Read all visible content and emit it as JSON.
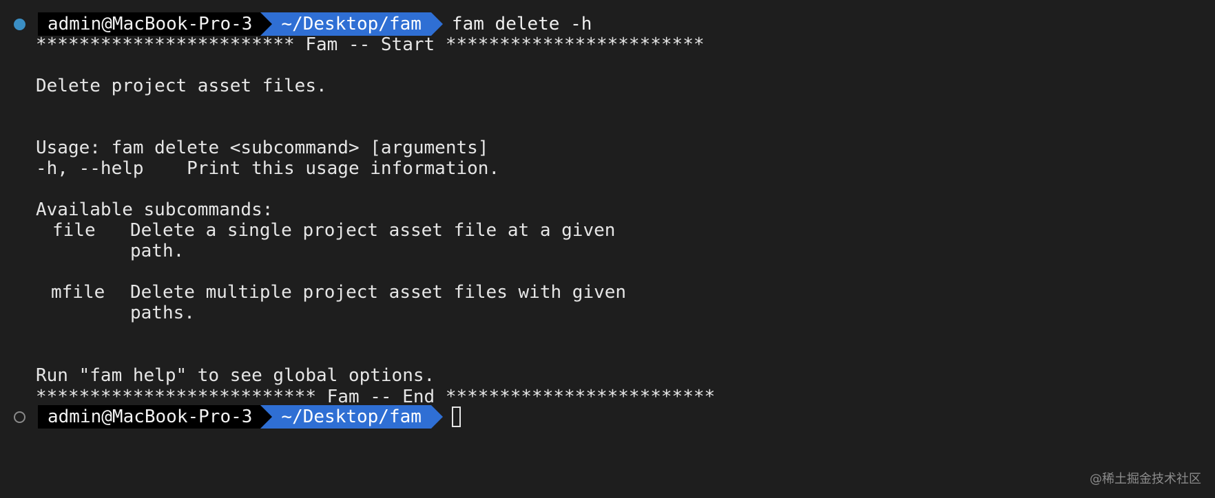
{
  "prompt": {
    "user_host": "admin@MacBook-Pro-3",
    "directory": "~/Desktop/fam",
    "command": "fam delete -h"
  },
  "output": {
    "banner_start": "************************ Fam -- Start ************************",
    "description": "Delete project asset files.",
    "usage": "Usage: fam delete <subcommand> [arguments]",
    "help_option": "-h, --help    Print this usage information.",
    "available_header": "Available subcommands:",
    "subcommands": [
      {
        "name": "file",
        "desc_line1": "Delete a single project asset file at a given",
        "desc_line2": "path."
      },
      {
        "name": "mfile",
        "desc_line1": "Delete multiple project asset files with given",
        "desc_line2": "paths."
      }
    ],
    "run_hint": "Run \"fam help\" to see global options.",
    "banner_end": "************************** Fam -- End *************************"
  },
  "prompt2": {
    "user_host": "admin@MacBook-Pro-3",
    "directory": "~/Desktop/fam"
  },
  "watermark": "@稀土掘金技术社区",
  "colors": {
    "background": "#1e1e1e",
    "text": "#e6e6e6",
    "user_segment": "#000000",
    "dir_segment": "#2f6fd4",
    "status_dot_done": "#3a8ec4"
  }
}
